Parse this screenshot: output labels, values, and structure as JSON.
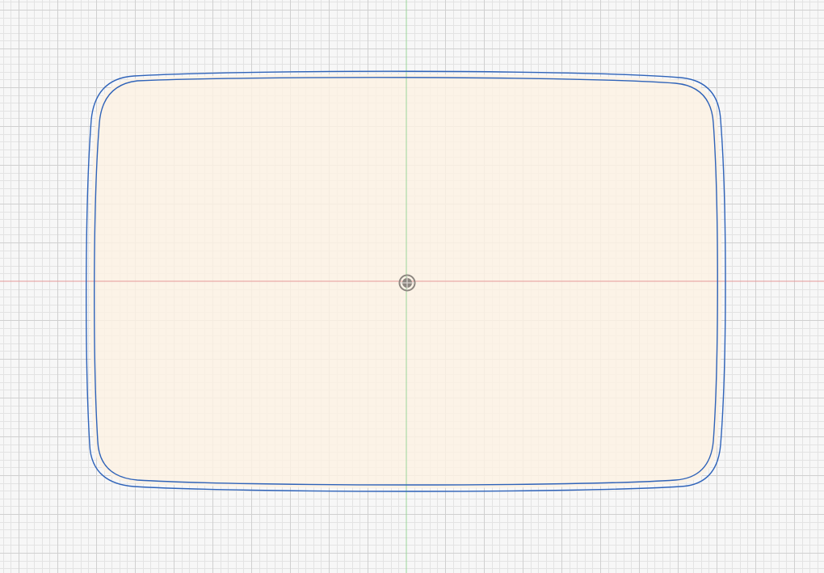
{
  "canvas": {
    "background_color": "#f7f7f7",
    "grid_minor_color": "#e3e3e3",
    "grid_major_color": "#d0d0d0",
    "axis_horizontal_color": "#e69a9a",
    "axis_vertical_color": "#9ad49a",
    "grid": true
  },
  "sketch": {
    "profile_fill_color": "#fdf1e3",
    "profile_stroke_color": "#2f63b9",
    "origin_marker_color": "#8c8680",
    "origin_marker": "origin-point-icon"
  }
}
